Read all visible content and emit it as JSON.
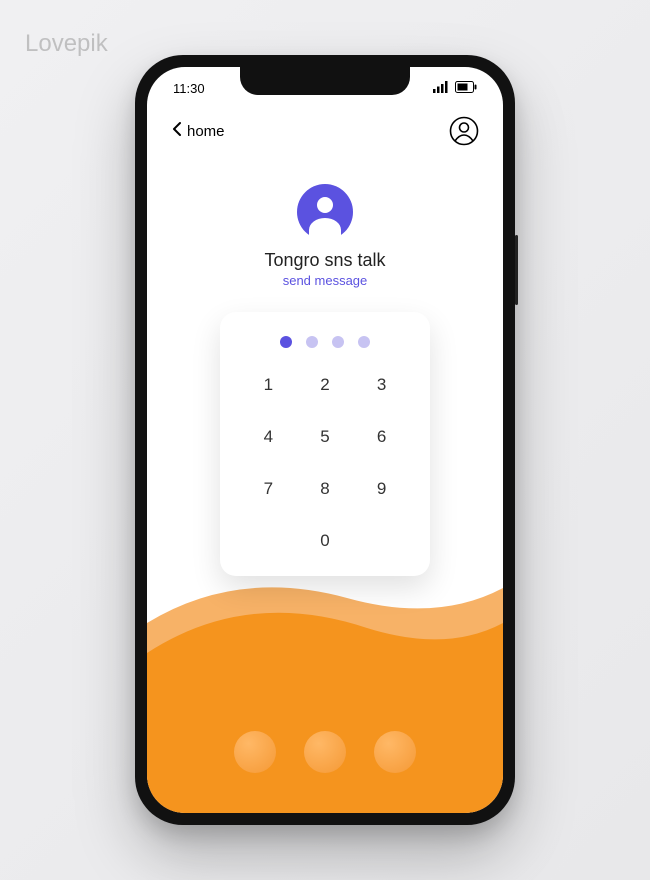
{
  "watermark": {
    "main": "Lovepik",
    "corner": "Lovepik"
  },
  "status_bar": {
    "time": "11:30"
  },
  "nav": {
    "back_label": "home"
  },
  "contact": {
    "name": "Tongro sns talk",
    "action": "send message"
  },
  "pin": {
    "total": 4,
    "entered": 1
  },
  "keypad": {
    "keys": [
      "1",
      "2",
      "3",
      "4",
      "5",
      "6",
      "7",
      "8",
      "9",
      "0"
    ]
  },
  "colors": {
    "accent": "#5b52e0",
    "orange_main": "#f5941e",
    "orange_light": "#f7b267"
  }
}
